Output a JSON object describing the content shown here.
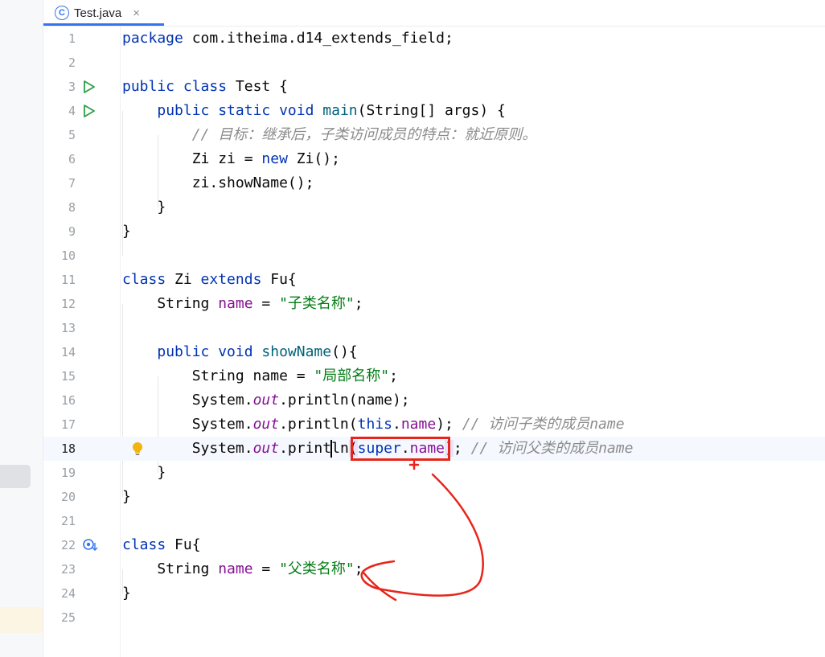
{
  "tab": {
    "icon_letter": "C",
    "title": "Test.java",
    "close": "×"
  },
  "colors": {
    "keyword": "#0033b3",
    "field": "#871094",
    "string": "#067d17",
    "comment": "#8c8c8c",
    "annotation": "#e8251b",
    "accent": "#3574f0"
  },
  "gutter_icons": {
    "run_main": "run-triangle-icon",
    "run_class": "run-triangle-icon",
    "intention": "lightbulb-icon",
    "overridden": "implemented-marker-icon"
  },
  "current_line": 18,
  "lines": [
    {
      "n": "1",
      "t": [
        [
          "kw",
          "package "
        ],
        [
          "",
          "com.itheima.d14_extends_field;"
        ]
      ]
    },
    {
      "n": "2",
      "t": []
    },
    {
      "n": "3",
      "t": [
        [
          "kw",
          "public class "
        ],
        [
          "",
          "Test {"
        ]
      ]
    },
    {
      "n": "4",
      "t": [
        [
          "",
          "    "
        ],
        [
          "kw",
          "public static void "
        ],
        [
          "meth",
          "main"
        ],
        [
          "",
          "(String[] args) {"
        ]
      ]
    },
    {
      "n": "5",
      "t": [
        [
          "",
          "        "
        ],
        [
          "cmt",
          "// 目标：继承后，子类访问成员的特点：就近原则。"
        ]
      ]
    },
    {
      "n": "6",
      "t": [
        [
          "",
          "        Zi zi = "
        ],
        [
          "kw",
          "new "
        ],
        [
          "",
          "Zi();"
        ]
      ]
    },
    {
      "n": "7",
      "t": [
        [
          "",
          "        zi.showName();"
        ]
      ]
    },
    {
      "n": "8",
      "t": [
        [
          "",
          "    }"
        ]
      ]
    },
    {
      "n": "9",
      "t": [
        [
          "",
          "}"
        ]
      ]
    },
    {
      "n": "10",
      "t": []
    },
    {
      "n": "11",
      "t": [
        [
          "kw",
          "class "
        ],
        [
          "",
          "Zi "
        ],
        [
          "kw",
          "extends "
        ],
        [
          "",
          "Fu{"
        ]
      ]
    },
    {
      "n": "12",
      "t": [
        [
          "",
          "    String "
        ],
        [
          "fld",
          "name"
        ],
        [
          "",
          " = "
        ],
        [
          "str",
          "\"子类名称\""
        ],
        [
          "",
          ";"
        ]
      ]
    },
    {
      "n": "13",
      "t": []
    },
    {
      "n": "14",
      "t": [
        [
          "",
          "    "
        ],
        [
          "kw",
          "public void "
        ],
        [
          "meth",
          "showName"
        ],
        [
          "",
          "(){"
        ]
      ]
    },
    {
      "n": "15",
      "t": [
        [
          "",
          "        String name = "
        ],
        [
          "str",
          "\"局部名称\""
        ],
        [
          "",
          ";"
        ]
      ]
    },
    {
      "n": "16",
      "t": [
        [
          "",
          "        System."
        ],
        [
          "static",
          "out"
        ],
        [
          "",
          ".println(name);"
        ]
      ]
    },
    {
      "n": "17",
      "t": [
        [
          "",
          "        System."
        ],
        [
          "static",
          "out"
        ],
        [
          "",
          ".println("
        ],
        [
          "kw",
          "this"
        ],
        [
          "",
          "."
        ],
        [
          "fld",
          "name"
        ],
        [
          "",
          "); "
        ],
        [
          "cmt",
          "// 访问子类的成员name"
        ]
      ]
    },
    {
      "n": "18",
      "t": [
        [
          "",
          "        System."
        ],
        [
          "static",
          "out"
        ],
        [
          "",
          ".print"
        ],
        [
          "caret",
          ""
        ],
        [
          "",
          "ln"
        ],
        [
          "paren-hl",
          "("
        ],
        [
          "kw",
          "super"
        ],
        [
          "",
          "."
        ],
        [
          "fld",
          "name"
        ],
        [
          "paren-hl",
          ")"
        ],
        [
          "",
          "; "
        ],
        [
          "cmt",
          "// 访问父类的成员name"
        ]
      ]
    },
    {
      "n": "19",
      "t": [
        [
          "",
          "    }"
        ]
      ]
    },
    {
      "n": "20",
      "t": [
        [
          "",
          "}"
        ]
      ]
    },
    {
      "n": "21",
      "t": []
    },
    {
      "n": "22",
      "t": [
        [
          "kw",
          "class "
        ],
        [
          "",
          "Fu{"
        ]
      ]
    },
    {
      "n": "23",
      "t": [
        [
          "",
          "    String "
        ],
        [
          "fld",
          "name"
        ],
        [
          "",
          " = "
        ],
        [
          "str",
          "\"父类名称\""
        ],
        [
          "",
          ";"
        ]
      ]
    },
    {
      "n": "24",
      "t": [
        [
          "",
          "}"
        ]
      ]
    },
    {
      "n": "25",
      "t": []
    }
  ]
}
